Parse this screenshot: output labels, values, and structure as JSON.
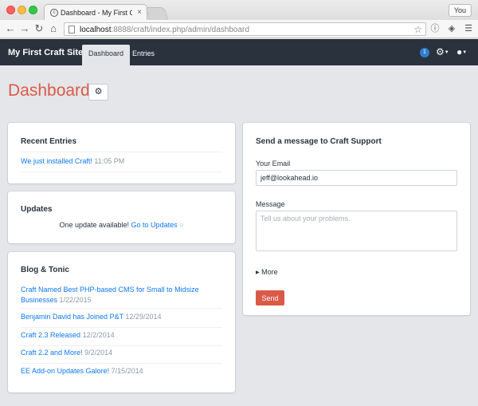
{
  "browser": {
    "tab_title": "Dashboard - My First Craft",
    "tab_close": "×",
    "profile": "You",
    "url_host": "localhost",
    "url_rest": ":8888/craft/index.php/admin/dashboard"
  },
  "header": {
    "site_name": "My First Craft Site",
    "nav": [
      {
        "label": "Dashboard"
      },
      {
        "label": "Entries"
      }
    ],
    "notification_count": "1"
  },
  "page": {
    "title": "Dashboard"
  },
  "recent_entries": {
    "title": "Recent Entries",
    "items": [
      {
        "title": "We just installed Craft!",
        "time": "11:05 PM"
      }
    ]
  },
  "updates": {
    "title": "Updates",
    "message": "One update available!",
    "link": "Go to Updates"
  },
  "blog": {
    "title": "Blog & Tonic",
    "items": [
      {
        "title": "Craft Named Best PHP-based CMS for Small to Midsize Businesses",
        "date": "1/22/2015"
      },
      {
        "title": "Benjamin David has Joined P&T",
        "date": "12/29/2014"
      },
      {
        "title": "Craft 2.3 Released",
        "date": "12/2/2014"
      },
      {
        "title": "Craft 2.2 and More!",
        "date": "9/2/2014"
      },
      {
        "title": "EE Add-on Updates Galore!",
        "date": "7/15/2014"
      }
    ]
  },
  "support": {
    "title": "Send a message to Craft Support",
    "email_label": "Your Email",
    "email_value": "jeff@lookahead.io",
    "message_label": "Message",
    "message_placeholder": "Tell us about your problems.",
    "more_label": "More",
    "send_label": "Send"
  },
  "colors": {
    "header_bg": "#29323d",
    "accent_red": "#da5a47",
    "link_blue": "#0d78f2",
    "badge_blue": "#2f7fd0",
    "page_bg": "#e4e6e9"
  }
}
